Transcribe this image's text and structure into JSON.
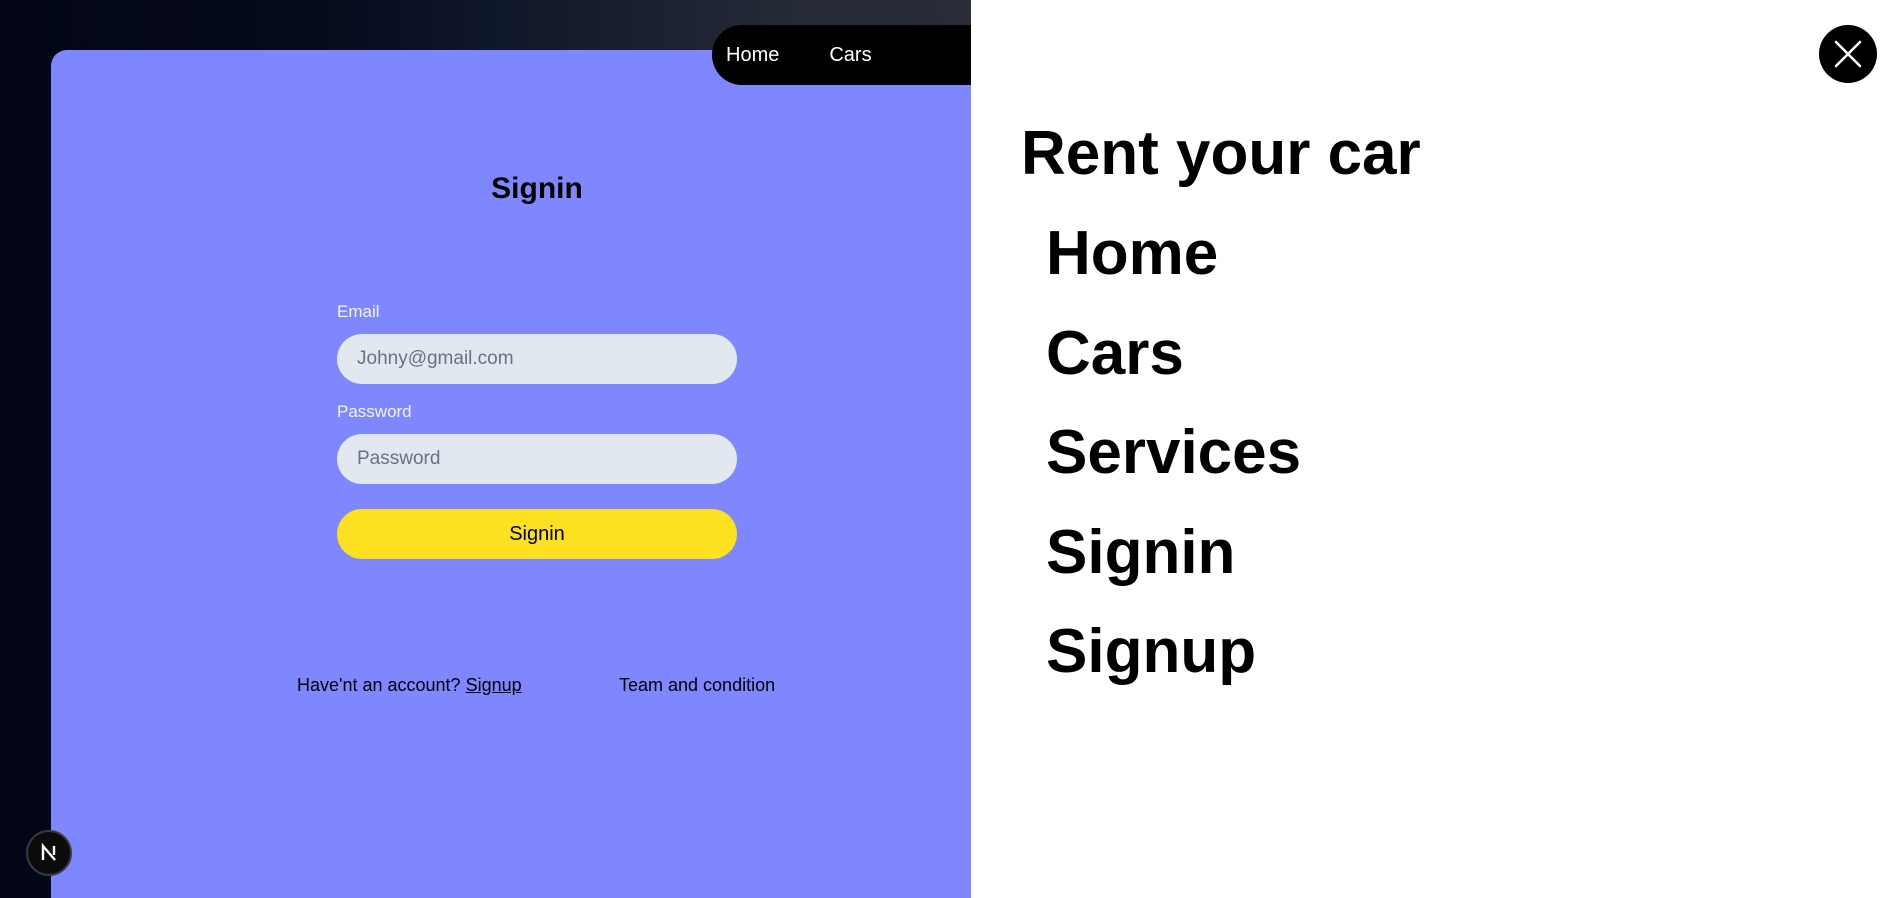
{
  "top_nav": {
    "items": [
      "Home",
      "Cars"
    ]
  },
  "signin_form": {
    "title": "Signin",
    "email_label": "Email",
    "email_placeholder": "Johny@gmail.com",
    "email_value": "",
    "password_label": "Password",
    "password_placeholder": "Password",
    "password_value": "",
    "submit_label": "Signin",
    "no_account_text": "Have'nt an account?",
    "signup_link": "Signup",
    "terms_link": "Team and condition"
  },
  "badge": {
    "letter": "N",
    "icon": "nextjs-logo-icon"
  },
  "side_menu": {
    "brand": "Rent your car",
    "close_icon": "close-icon",
    "items": [
      "Home",
      "Cars",
      "Services",
      "Signin",
      "Signup"
    ]
  },
  "colors": {
    "card_bg": "#7f87ff",
    "button_bg": "#fde01f",
    "input_bg": "#e2e8f0",
    "menu_bg": "#ffffff",
    "nav_bg": "#000000"
  }
}
